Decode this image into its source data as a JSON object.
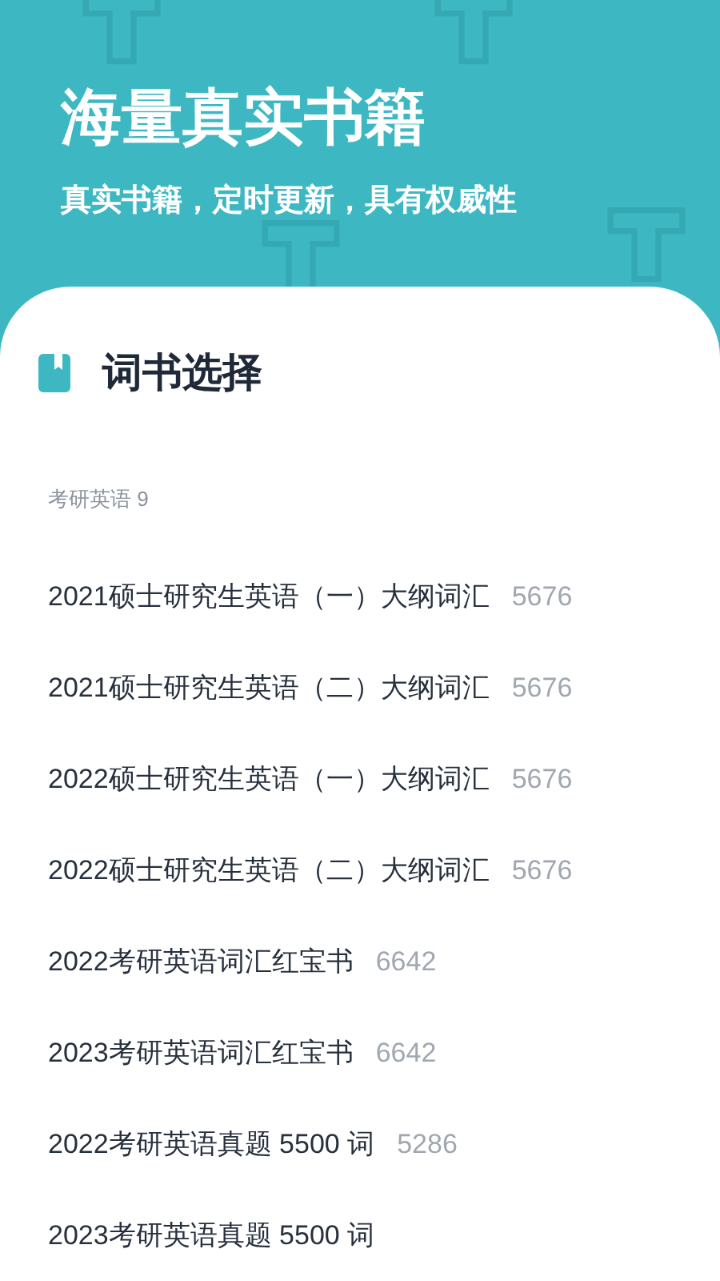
{
  "header": {
    "title": "海量真实书籍",
    "subtitle": "真实书籍，定时更新，具有权威性"
  },
  "panel": {
    "title": "词书选择",
    "section": "考研英语 9",
    "books": [
      {
        "name": "2021硕士研究生英语（一）大纲词汇",
        "count": "5676"
      },
      {
        "name": "2021硕士研究生英语（二）大纲词汇",
        "count": "5676"
      },
      {
        "name": "2022硕士研究生英语（一）大纲词汇",
        "count": "5676"
      },
      {
        "name": "2022硕士研究生英语（二）大纲词汇",
        "count": "5676"
      },
      {
        "name": "2022考研英语词汇红宝书",
        "count": "6642"
      },
      {
        "name": "2023考研英语词汇红宝书",
        "count": "6642"
      },
      {
        "name": "2022考研英语真题 5500 词",
        "count": "5286"
      },
      {
        "name": "2023考研英语真题 5500 词"
      }
    ]
  }
}
